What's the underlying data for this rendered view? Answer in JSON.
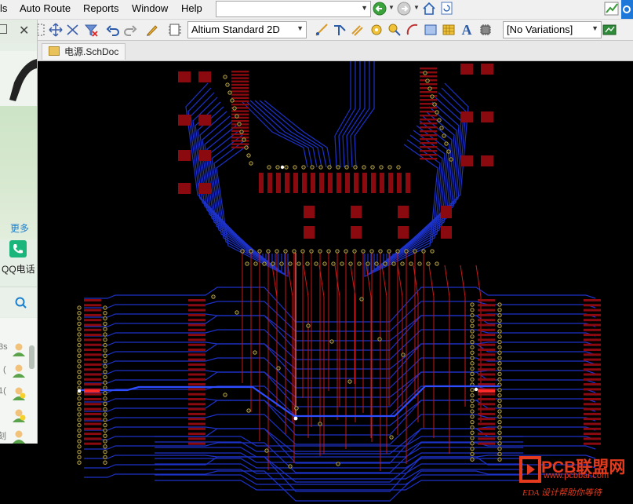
{
  "menubar": {
    "items": [
      {
        "label": "ls",
        "key": ""
      },
      {
        "label": "Auto Route",
        "key": "A"
      },
      {
        "label": "Reports",
        "key": "R"
      },
      {
        "label": "Window",
        "key": "W"
      },
      {
        "label": "Help",
        "key": "H"
      }
    ]
  },
  "toolbar": {
    "view_mode": "Altium Standard 2D",
    "variations": "[No Variations]"
  },
  "tabs": {
    "document_tab": "电源.SchDoc"
  },
  "qq_panel": {
    "more_label": "更多",
    "phone_label": "QQ电话",
    "partial_chars": [
      "3s",
      "(",
      "1(",
      "刻"
    ]
  },
  "watermark": {
    "brand_name": "PCB联盟网",
    "url": "www.pcbbar.com",
    "slogan": "EDA 设计帮助你等待"
  },
  "colors": {
    "canvas": "#000000",
    "top_track": "#c81818",
    "bottom_track": "#1c32c8",
    "highlight_track": "#2d4dff",
    "pad": "#8a0a10",
    "brand": "#e43a1d"
  }
}
